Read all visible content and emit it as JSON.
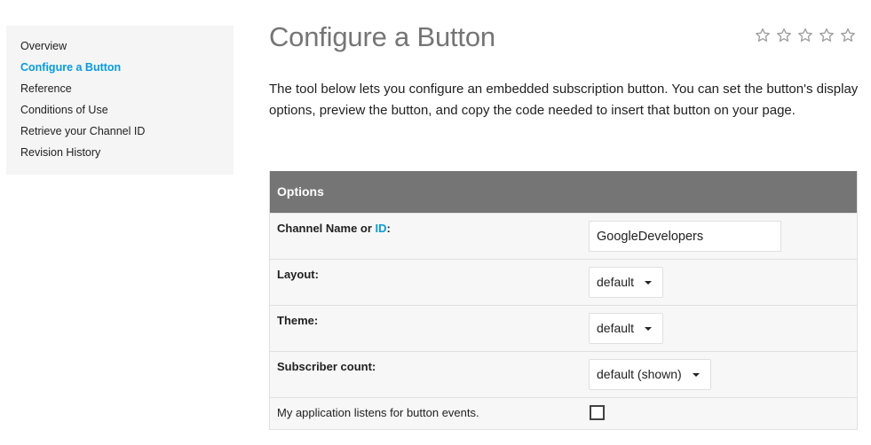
{
  "sidebar": {
    "items": [
      {
        "label": "Overview",
        "active": false
      },
      {
        "label": "Configure a Button",
        "active": true
      },
      {
        "label": "Reference",
        "active": false
      },
      {
        "label": "Conditions of Use",
        "active": false
      },
      {
        "label": "Retrieve your Channel ID",
        "active": false
      },
      {
        "label": "Revision History",
        "active": false
      }
    ]
  },
  "main": {
    "title": "Configure a Button",
    "rating_stars": 5,
    "intro": "The tool below lets you configure an embedded subscription button. You can set the button's display options, preview the button, and copy the code needed to insert that button on your page."
  },
  "options": {
    "header": "Options",
    "channel": {
      "label_prefix": "Channel Name or ",
      "label_link": "ID",
      "label_suffix": ":",
      "value": "GoogleDevelopers"
    },
    "layout": {
      "label": "Layout:",
      "value": "default"
    },
    "theme": {
      "label": "Theme:",
      "value": "default"
    },
    "subscriber_count": {
      "label": "Subscriber count:",
      "value": "default (shown)"
    },
    "events": {
      "label": "My application listens for button events.",
      "checked": false
    }
  },
  "colors": {
    "accent": "#039be5",
    "header_bg": "#757575",
    "sidebar_bg": "#f5f5f5"
  }
}
